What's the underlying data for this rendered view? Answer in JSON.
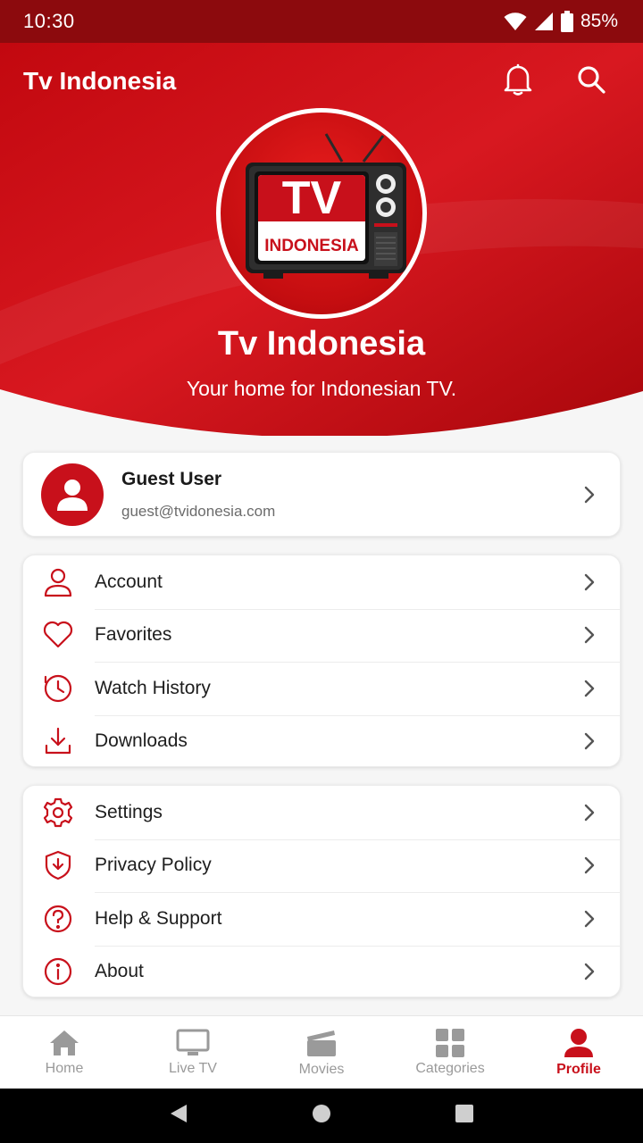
{
  "status_bar": {
    "time": "10:30",
    "battery": "85%"
  },
  "app_bar": {
    "title": "Tv Indonesia",
    "icons": [
      "bell-icon",
      "search-icon"
    ]
  },
  "hero": {
    "logo_text_top": "TV",
    "logo_text_bottom": "INDONESIA",
    "title": "Tv Indonesia",
    "subtitle": "Your home for Indonesian TV."
  },
  "profile": {
    "name": "Guest User",
    "email": "guest@tvidonesia.com"
  },
  "menu_group_1": [
    {
      "label": "Account",
      "icon": "user-icon"
    },
    {
      "label": "Favorites",
      "icon": "heart-icon"
    },
    {
      "label": "Watch History",
      "icon": "clock-icon"
    },
    {
      "label": "Downloads",
      "icon": "download-icon"
    }
  ],
  "menu_group_2": [
    {
      "label": "Settings",
      "icon": "gear-icon"
    },
    {
      "label": "Privacy Policy",
      "icon": "shield-icon"
    },
    {
      "label": "Help & Support",
      "icon": "help-icon"
    },
    {
      "label": "About",
      "icon": "info-icon"
    }
  ],
  "bottom_nav": [
    {
      "label": "Home",
      "icon": "home-icon",
      "active": false
    },
    {
      "label": "Live TV",
      "icon": "monitor-icon",
      "active": false
    },
    {
      "label": "Movies",
      "icon": "clapper-icon",
      "active": false
    },
    {
      "label": "Categories",
      "icon": "grid-icon",
      "active": false
    },
    {
      "label": "Profile",
      "icon": "person-icon",
      "active": true
    }
  ],
  "colors": {
    "brand": "#c8101b",
    "status_bar": "#8c0a0d",
    "active_nav": "#c8101b",
    "inactive_nav": "#9a9a9a"
  }
}
